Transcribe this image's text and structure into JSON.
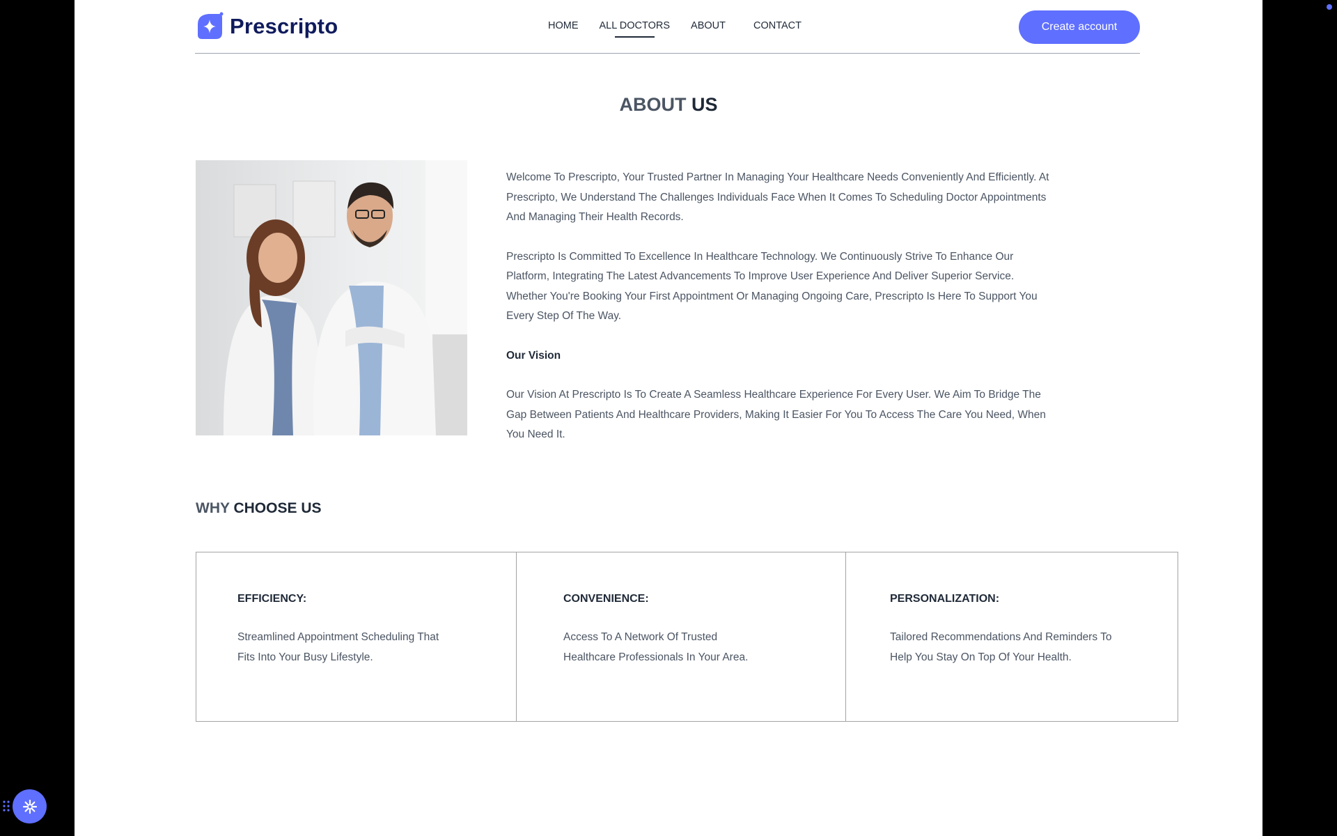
{
  "brand": {
    "name": "Prescripto",
    "accent": "#5f6fff",
    "dark": "#0f1b5c"
  },
  "nav": {
    "items": [
      {
        "label": "HOME"
      },
      {
        "label": "ALL DOCTORS",
        "active": true
      },
      {
        "label": "ABOUT"
      },
      {
        "label": "CONTACT"
      }
    ],
    "cta_label": "Create account"
  },
  "about": {
    "title_light": "ABOUT",
    "title_bold": "US",
    "image_alt": "doctors-photo",
    "paragraph1": "Welcome To Prescripto, Your Trusted Partner In Managing Your Healthcare Needs Conveniently And Efficiently. At Prescripto, We Understand The Challenges Individuals Face When It Comes To Scheduling Doctor Appointments And Managing Their Health Records.",
    "paragraph2": "Prescripto Is Committed To Excellence In Healthcare Technology. We Continuously Strive To Enhance Our Platform, Integrating The Latest Advancements To Improve User Experience And Deliver Superior Service. Whether You're Booking Your First Appointment Or Managing Ongoing Care, Prescripto Is Here To Support You Every Step Of The Way.",
    "vision_heading": "Our Vision",
    "vision_text": "Our Vision At Prescripto Is To Create A Seamless Healthcare Experience For Every User. We Aim To Bridge The Gap Between Patients And Healthcare Providers, Making It Easier For You To Access The Care You Need, When You Need It."
  },
  "why": {
    "title_light": "WHY",
    "title_bold": "CHOOSE US",
    "cards": [
      {
        "title": "EFFICIENCY:",
        "desc": "Streamlined Appointment Scheduling That Fits Into Your Busy Lifestyle."
      },
      {
        "title": "CONVENIENCE:",
        "desc": "Access To A Network Of Trusted Healthcare Professionals In Your Area."
      },
      {
        "title": "PERSONALIZATION:",
        "desc": "Tailored Recommendations And Reminders To Help You Stay On Top Of Your Health."
      }
    ]
  },
  "widgets": {
    "fab_icon": "sparkle-icon",
    "drag_icon": "drag-handle-icon"
  }
}
